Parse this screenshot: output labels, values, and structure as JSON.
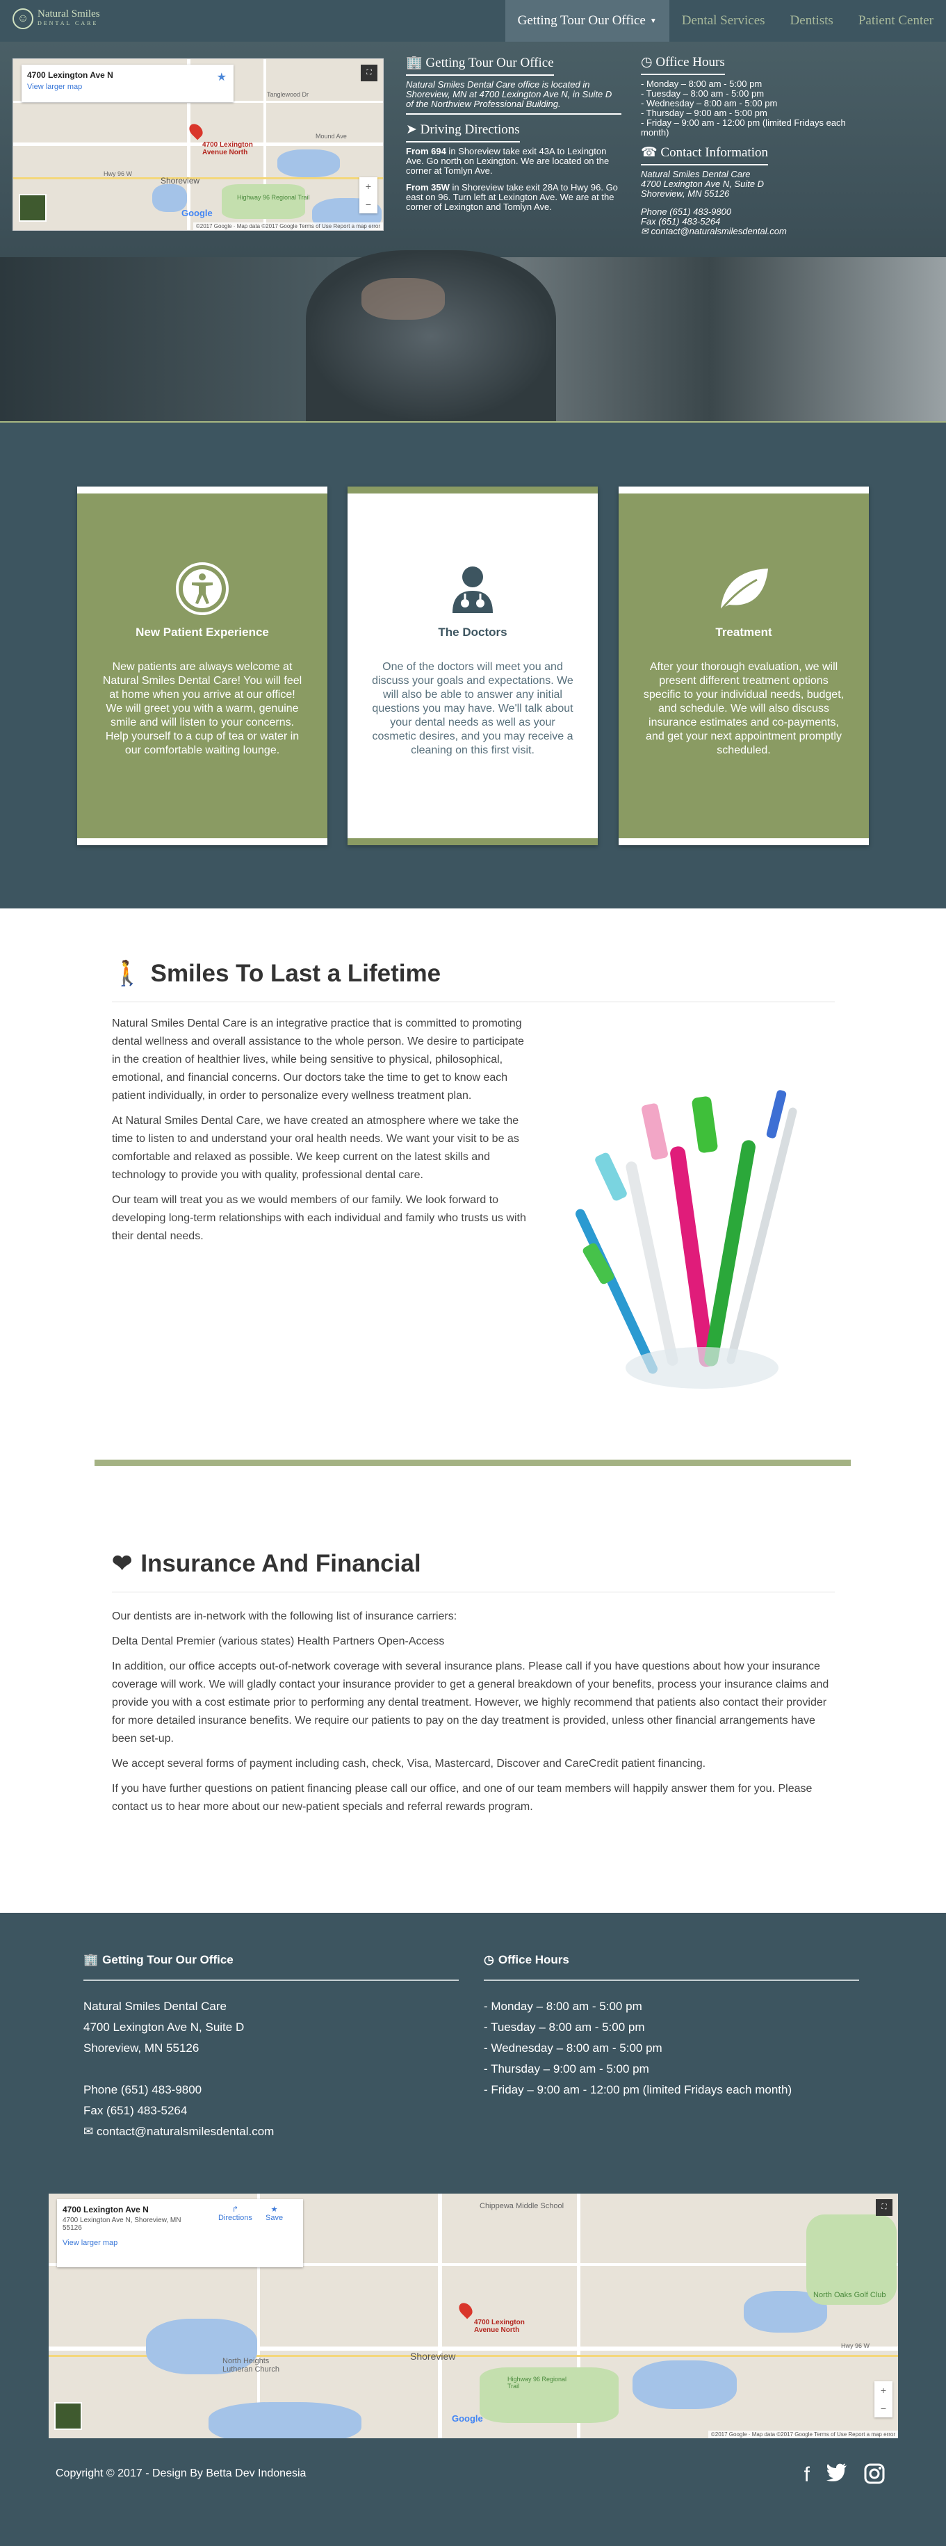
{
  "nav": {
    "logo_title": "Natural Smiles",
    "logo_sub": "DENTAL CARE",
    "items": [
      {
        "label": "Getting Tour Our Office",
        "active": true
      },
      {
        "label": "Dental Services",
        "active": false
      },
      {
        "label": "Dentists",
        "active": false
      },
      {
        "label": "Patient Center",
        "active": false
      }
    ]
  },
  "hero": {
    "map": {
      "address": "4700 Lexington Ave N",
      "view_larger": "View larger map",
      "pin_label_1": "4700 Lexington",
      "pin_label_2": "Avenue North",
      "google": "Google",
      "footer": "©2017 Google · Map data ©2017 Google   Terms of Use   Report a map error",
      "labels": [
        "Tanglewood Dr",
        "Mound Ave",
        "Hwy 96 W",
        "Shoreview",
        "Highway 96 Regional Trail"
      ]
    },
    "office": {
      "title": "Getting Tour Our Office",
      "text": "Natural Smiles Dental Care office is located in Shoreview, MN at 4700 Lexington Ave N, in Suite D of the Northview Professional Building."
    },
    "directions": {
      "title": "Driving Directions",
      "p1_bold": "From 694",
      "p1": " in Shoreview take exit 43A to Lexington Ave. Go north on Lexington. We are located on the corner at Tomlyn Ave.",
      "p2_bold": "From 35W",
      "p2": " in Shoreview take exit 28A to Hwy 96. Go east on 96. Turn left at Lexington Ave. We are at the corner of Lexington and Tomlyn Ave."
    },
    "hours": {
      "title": "Office Hours",
      "lines": [
        "- Monday – 8:00 am - 5:00 pm",
        "- Tuesday – 8:00 am - 5:00 pm",
        "- Wednesday – 8:00 am - 5:00 pm",
        "- Thursday – 9:00 am - 5:00 pm",
        "- Friday – 9:00 am - 12:00 pm (limited Fridays each month)"
      ]
    },
    "contact": {
      "title": "Contact Information",
      "name": "Natural Smiles Dental Care",
      "street": "4700 Lexington Ave N, Suite D",
      "city": "Shoreview, MN 55126",
      "phone": "Phone (651) 483-9800",
      "fax": "Fax (651) 483-5264",
      "email": "contact@naturalsmilesdental.com"
    }
  },
  "cards": [
    {
      "title": "New Patient Experience",
      "text": "New patients are always welcome at Natural Smiles Dental Care! You will feel at home when you arrive at our office! We will greet you with a warm, genuine smile and will listen to your concerns. Help yourself to a cup of tea or water in our comfortable waiting lounge."
    },
    {
      "title": "The Doctors",
      "text": "One of the doctors will meet you and discuss your goals and expectations. We will also be able to answer any initial questions you may have. We'll talk about your dental needs as well as your cosmetic desires, and you may receive a cleaning on this first visit."
    },
    {
      "title": "Treatment",
      "text": "After your thorough evaluation, we will present different treatment options specific to your individual needs, budget, and schedule. We will also discuss insurance estimates and co-payments, and get your next appointment promptly scheduled."
    }
  ],
  "smiles": {
    "title": "Smiles To Last a Lifetime",
    "paragraphs": [
      "Natural Smiles Dental Care is an integrative practice that is committed to promoting dental wellness and overall assistance to the whole person. We desire to participate in the creation of healthier lives, while being sensitive to physical, philosophical, emotional, and financial concerns. Our doctors take the time to get to know each patient individually, in order to personalize every wellness treatment plan.",
      "At Natural Smiles Dental Care, we have created an atmosphere where we take the time to listen to and understand your oral health needs. We want your visit to be as comfortable and relaxed as possible. We keep current on the latest skills and technology to provide you with quality, professional dental care.",
      "Our team will treat you as we would members of our family. We look forward to developing long-term relationships with each individual and family who trusts us with their dental needs."
    ]
  },
  "insurance": {
    "title": "Insurance And Financial",
    "paragraphs": [
      "Our dentists are in-network with the following list of insurance carriers:",
      "Delta Dental Premier (various states) Health Partners Open-Access",
      "In addition, our office accepts out-of-network coverage with several insurance plans. Please call if you have questions about how your insurance coverage will work. We will gladly contact your insurance provider to get a general breakdown of your benefits, process your insurance claims and provide you with a cost estimate prior to performing any dental treatment. However, we highly recommend that patients also contact their provider for more detailed insurance benefits. We require our patients to pay on the day treatment is provided, unless other financial arrangements have been set-up.",
      "We accept several forms of payment including cash, check, Visa, Mastercard, Discover and CareCredit patient financing.",
      "If you have further questions on patient financing please call our office, and one of our team members will happily answer them for you. Please contact us to hear more about our new-patient specials and referral rewards program."
    ]
  },
  "footer": {
    "office_title": "Getting Tour Our Office",
    "name": "Natural Smiles Dental Care",
    "street": "4700 Lexington Ave N, Suite D",
    "city": "Shoreview, MN 55126",
    "phone": "Phone (651) 483-9800",
    "fax": "Fax (651) 483-5264",
    "email": "contact@naturalsmilesdental.com",
    "hours_title": "Office Hours",
    "hours": [
      "- Monday – 8:00 am - 5:00 pm",
      "- Tuesday – 8:00 am - 5:00 pm",
      "- Wednesday – 8:00 am - 5:00 pm",
      "- Thursday – 9:00 am - 5:00 pm",
      "- Friday – 9:00 am - 12:00 pm (limited Fridays each month)"
    ],
    "map": {
      "address": "4700 Lexington Ave N",
      "address_full": "4700 Lexington Ave N, Shoreview, MN 55126",
      "directions": "Directions",
      "save": "Save",
      "view_larger": "View larger map",
      "pin_label_1": "4700 Lexington",
      "pin_label_2": "Avenue North",
      "labels": [
        "Chippewa Middle School",
        "North Oaks Golf Club",
        "North Heights Lutheran Church",
        "Shoreview",
        "Highway 96 Regional Trail",
        "Hwy 96 W"
      ],
      "google": "Google",
      "footer": "©2017 Google · Map data ©2017 Google   Terms of Use   Report a map error"
    },
    "copyright": "Copyright © 2017 - Design By Betta Dev Indonesia"
  },
  "colors": {
    "nav_bg": "#3d5560",
    "accent_green": "#8a9b63",
    "line_green": "#a4b283"
  }
}
